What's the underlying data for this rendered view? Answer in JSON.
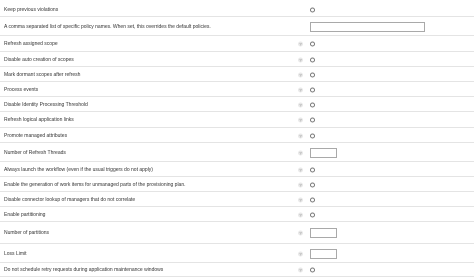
{
  "settings": [
    {
      "label": "Keep previous violations",
      "control": "checkbox",
      "help": false,
      "checked": false
    },
    {
      "label": "A comma separated list of specific policy names. When set, this overrides the default policies.",
      "control": "text",
      "width": "wide",
      "value": "",
      "help": false
    },
    {
      "label": "Refresh assigned scope",
      "control": "checkbox",
      "help": true,
      "checked": false
    },
    {
      "label": "Disable auto creation of scopes",
      "control": "checkbox",
      "help": true,
      "checked": false
    },
    {
      "label": "Mark dormant scopes after refresh",
      "control": "checkbox",
      "help": true,
      "checked": false
    },
    {
      "label": "Process events",
      "control": "checkbox",
      "help": true,
      "checked": false
    },
    {
      "label": "Disable Identity Processing Threshold",
      "control": "checkbox",
      "help": true,
      "checked": false
    },
    {
      "label": "Refresh logical application links",
      "control": "checkbox",
      "help": true,
      "checked": false
    },
    {
      "label": "Promote managed attributes",
      "control": "checkbox",
      "help": true,
      "checked": false
    },
    {
      "label": "Number of Refresh Threads",
      "control": "text",
      "width": "short",
      "value": "",
      "help": true
    },
    {
      "label": "Always launch the workflow (even if the usual triggers do not apply)",
      "control": "checkbox",
      "help": true,
      "checked": false
    },
    {
      "label": "Enable the generation of work items for unmanaged parts of the provisioning plan.",
      "control": "checkbox",
      "help": true,
      "checked": false
    },
    {
      "label": "Disable connector lookup of managers that do not correlate",
      "control": "checkbox",
      "help": true,
      "checked": false
    },
    {
      "label": "Enable partitioning",
      "control": "checkbox",
      "help": true,
      "checked": false
    },
    {
      "label": "Number of partitions",
      "control": "text",
      "width": "short",
      "value": "",
      "help": true
    },
    {
      "label": "Loss Limit",
      "control": "text",
      "width": "short",
      "value": "",
      "help": true
    },
    {
      "label": "Do not schedule retry requests during application maintenance windows",
      "control": "checkbox",
      "help": true,
      "checked": false
    }
  ],
  "help_icon_glyph": "?",
  "colors": {
    "text": "#333333",
    "divider": "#e4e4e4",
    "input_border": "#a9a9a9",
    "help_bg": "#e8e8e8"
  }
}
